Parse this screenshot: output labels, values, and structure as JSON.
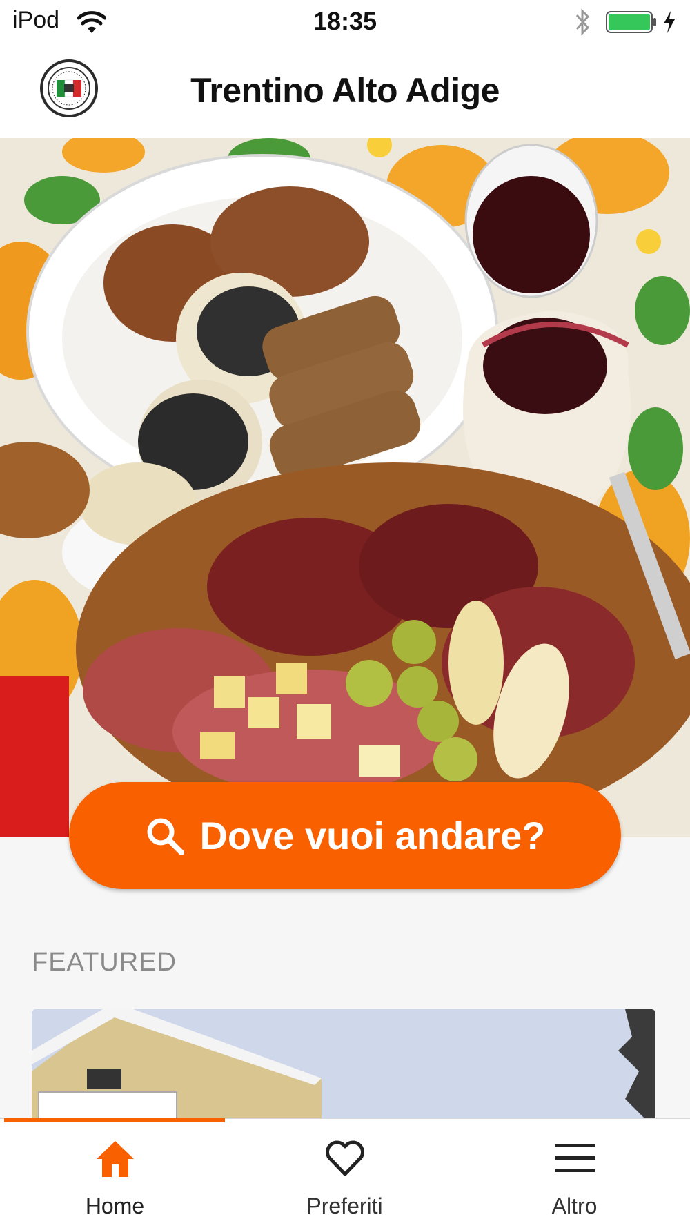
{
  "status_bar": {
    "carrier": "iPod",
    "time": "18:35",
    "icons": [
      "wifi-icon",
      "bluetooth-icon",
      "battery-icon",
      "charging-bolt-icon"
    ],
    "battery_color": "#35c759"
  },
  "header": {
    "title": "Trentino Alto Adige",
    "logo_icon": "italy-flag-seal-icon"
  },
  "hero": {
    "image": "food platter with bread, wine, cheese and cured meats"
  },
  "search": {
    "label": "Dove vuoi andare?",
    "icon": "search-icon"
  },
  "featured": {
    "section_title": "FEATURED"
  },
  "tab_bar": {
    "tabs": [
      {
        "label": "Home",
        "icon": "home-icon",
        "active": true
      },
      {
        "label": "Preferiti",
        "icon": "heart-icon",
        "active": false
      },
      {
        "label": "Altro",
        "icon": "menu-icon",
        "active": false
      }
    ]
  },
  "colors": {
    "accent": "#f96000",
    "background": "#f6f6f6"
  }
}
